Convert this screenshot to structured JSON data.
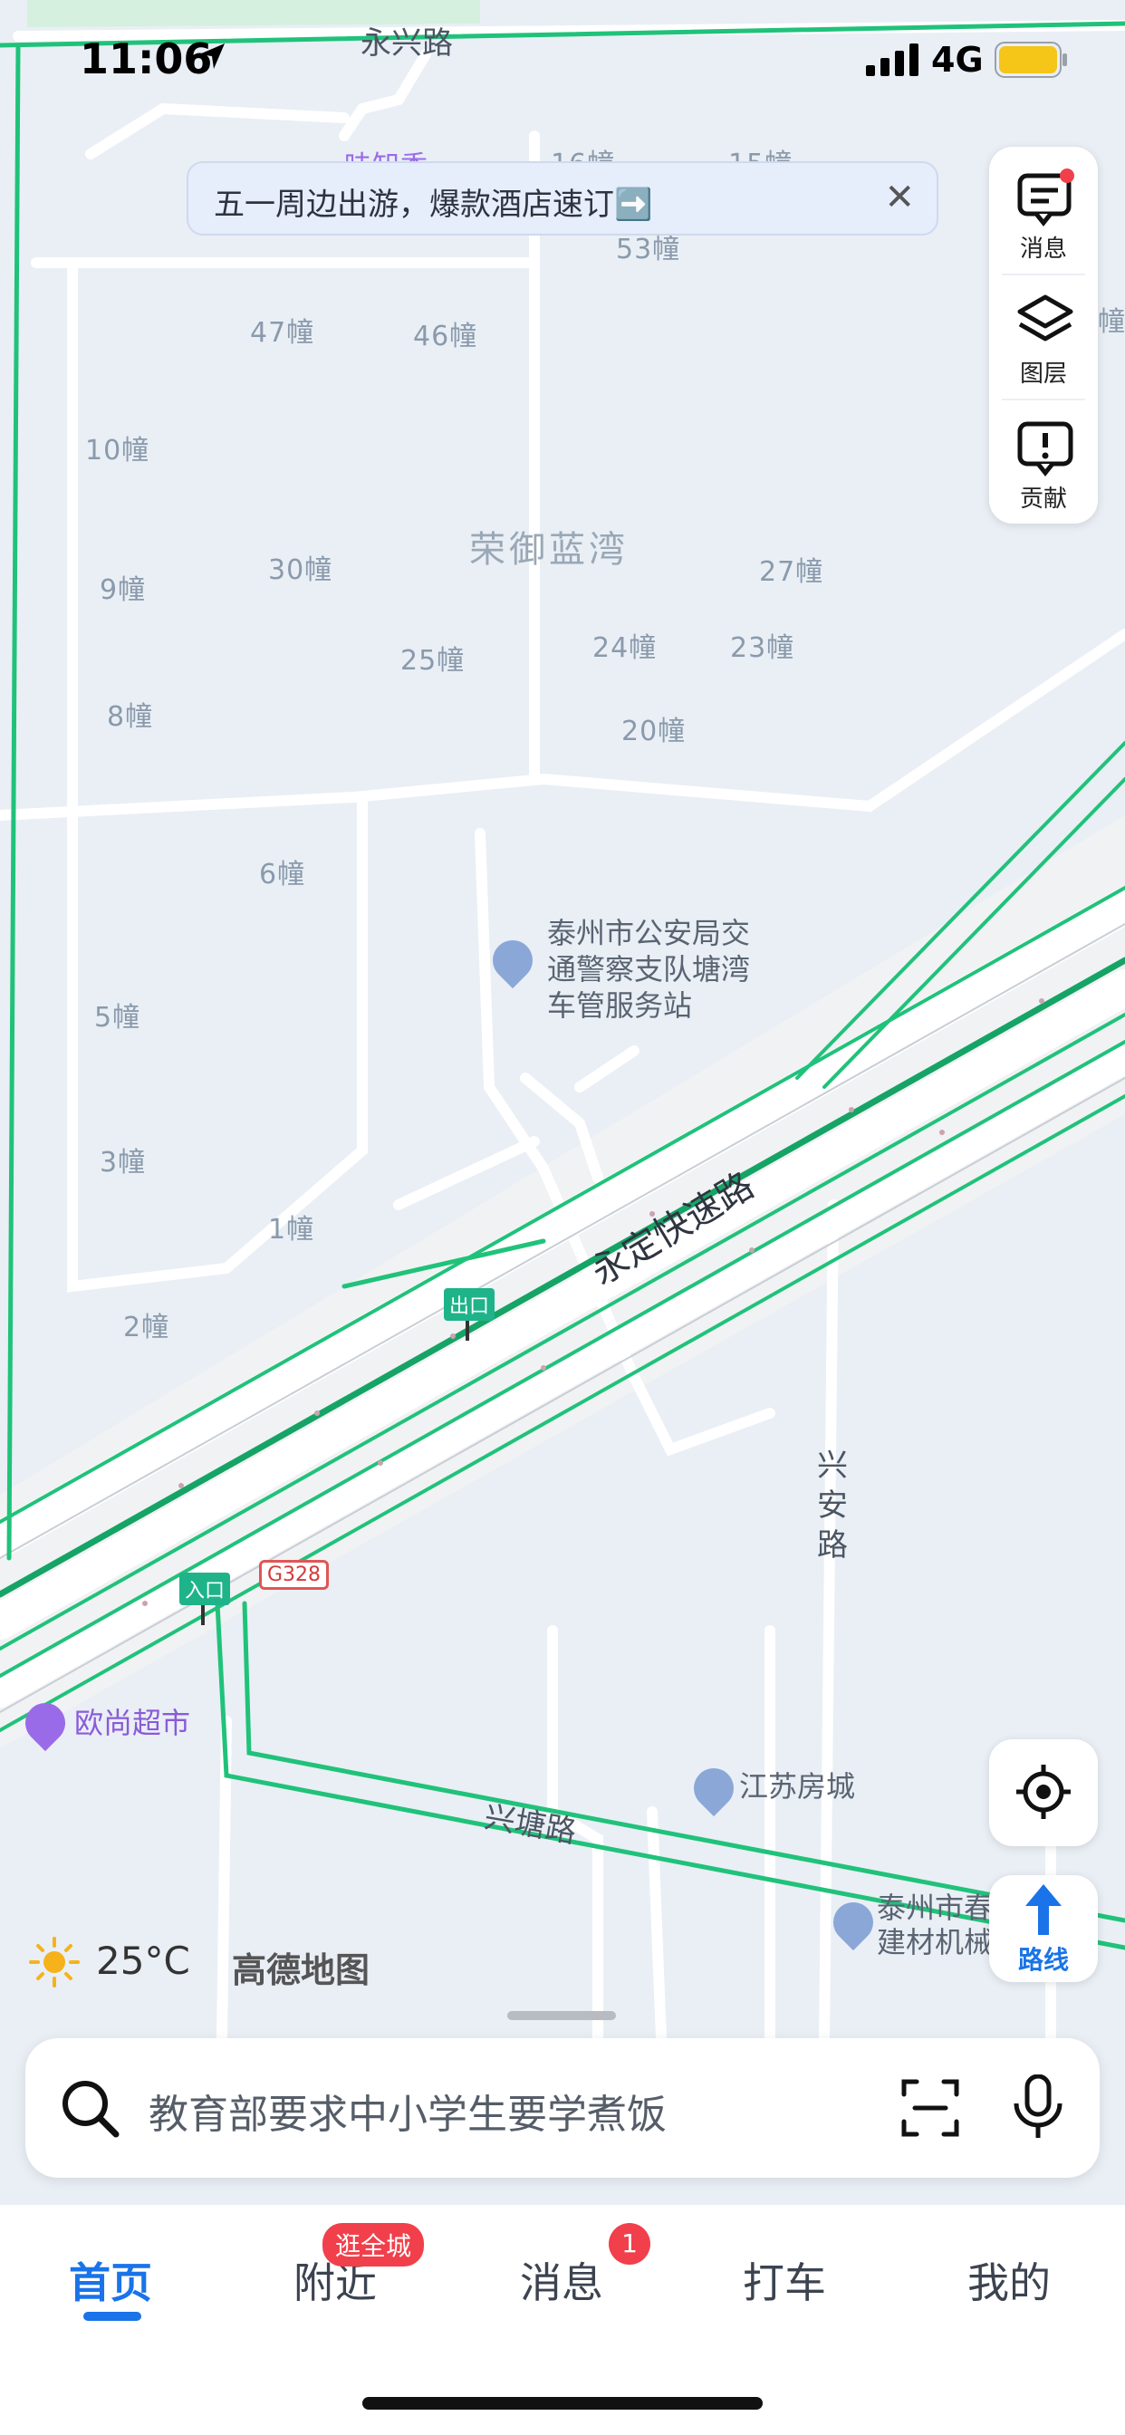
{
  "status_bar": {
    "time": "11:06",
    "network": "4G"
  },
  "map": {
    "road_labels": {
      "yongxing": "永兴路",
      "expressway": "永定快速路",
      "xingan": "兴安路",
      "xingtang": "兴塘路"
    },
    "area_label": "荣御蓝湾",
    "building_labels": [
      "16幢",
      "15幢",
      "53幢",
      "47幢",
      "46幢",
      "10幢",
      "9幢",
      "30幢",
      "27幢",
      "25幢",
      "24幢",
      "23幢",
      "8幢",
      "20幢",
      "6幢",
      "5幢",
      "3幢",
      "1幢",
      "2幢"
    ],
    "partial_label_top": "味知香",
    "partial_label_right": "幢",
    "exit_sign": "出口",
    "entrance_sign": "入口",
    "highway_shield": "G328",
    "pois": {
      "police": [
        "泰州市公安局交",
        "通警察支队塘湾",
        "车管服务站"
      ],
      "auchan": "欧尚超市",
      "jiangsu_house": "江苏房城",
      "building_mat": [
        "泰州市春",
        "建材机械"
      ]
    },
    "colors": {
      "traffic_green": "#20c27a",
      "poi_purple": "#9a6be8",
      "poi_blue": "#8aa7d8"
    }
  },
  "banner": {
    "text": "五一周边出游，爆款酒店速订➡️",
    "close": "✕"
  },
  "tools": {
    "messages": "消息",
    "layers": "图层",
    "contribute": "贡献",
    "route": "路线"
  },
  "weather": {
    "temperature": "25°C",
    "brand": "高德地图"
  },
  "search": {
    "placeholder": "教育部要求中小学生要学煮饭"
  },
  "tabs": {
    "home": "首页",
    "nearby": "附近",
    "nearby_badge": "逛全城",
    "messages": "消息",
    "messages_badge": "1",
    "taxi": "打车",
    "mine": "我的"
  }
}
